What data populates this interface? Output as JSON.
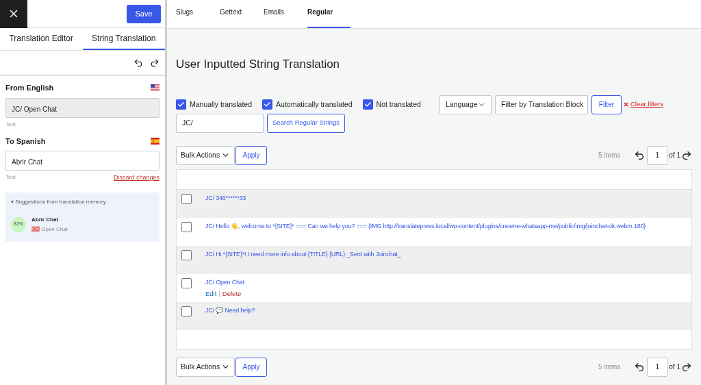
{
  "sidebar": {
    "save_button": "Save",
    "tabs": [
      {
        "label": "Translation Editor",
        "selected": false
      },
      {
        "label": "String Translation",
        "selected": true
      }
    ],
    "source": {
      "heading": "From English",
      "value": "JC/ Open Chat",
      "hint": "Text"
    },
    "target": {
      "heading": "To Spanish",
      "value": "Abrir Chat",
      "hint": "Text",
      "discard": "Discard changes"
    },
    "suggestions": {
      "title": "▾ Suggestions from translation memory",
      "items": [
        {
          "score": "82%",
          "translation": "Abrir Chat",
          "match": "JC/",
          "rest": " Open Chat"
        }
      ]
    }
  },
  "tabs": [
    {
      "label": "Slugs",
      "selected": false
    },
    {
      "label": "Gettext",
      "selected": false
    },
    {
      "label": "Emails",
      "selected": false
    },
    {
      "label": "Regular",
      "selected": true
    }
  ],
  "page_title": "User Inputted String Translation",
  "filters": [
    {
      "label": "Manually translated",
      "checked": true
    },
    {
      "label": "Automatically translated",
      "checked": true
    },
    {
      "label": "Not translated",
      "checked": true
    }
  ],
  "language_select": "Language",
  "block_select": "Filter by Translation Block",
  "filter_button": "Filter",
  "clear_filters": "Clear filters",
  "search": {
    "value": "JC/",
    "button": "Search Regular Strings"
  },
  "top_bar": {
    "bulk": "Bulk Actions",
    "apply": "Apply",
    "count": "5 items",
    "page": "1",
    "of": "of 1"
  },
  "rows": [
    {
      "text": "JC/ 346******33",
      "checked": false
    },
    {
      "text": "JC/ Hello 👋, welcome to *{SITE}* === Can we help you? === {IMG http://translatepress.local/wp-content/plugins/creame-whatsapp-me/public/img/joinchat-ok.webm 180}",
      "checked": false
    },
    {
      "text": "JC/ Hi *{SITE}*! I need more info about {TITLE} {URL} _Sent with Joinchat_",
      "checked": false
    },
    {
      "text": "JC/ Open Chat",
      "checked": false,
      "actions": [
        "Edit",
        "|",
        "Delete"
      ]
    },
    {
      "text": "JC/ 💬 Need help?",
      "checked": false
    }
  ],
  "bottom_bar": {
    "bulk": "Bulk Actions",
    "apply": "Apply",
    "count": "5 items",
    "page": "1",
    "of": "of 1"
  }
}
